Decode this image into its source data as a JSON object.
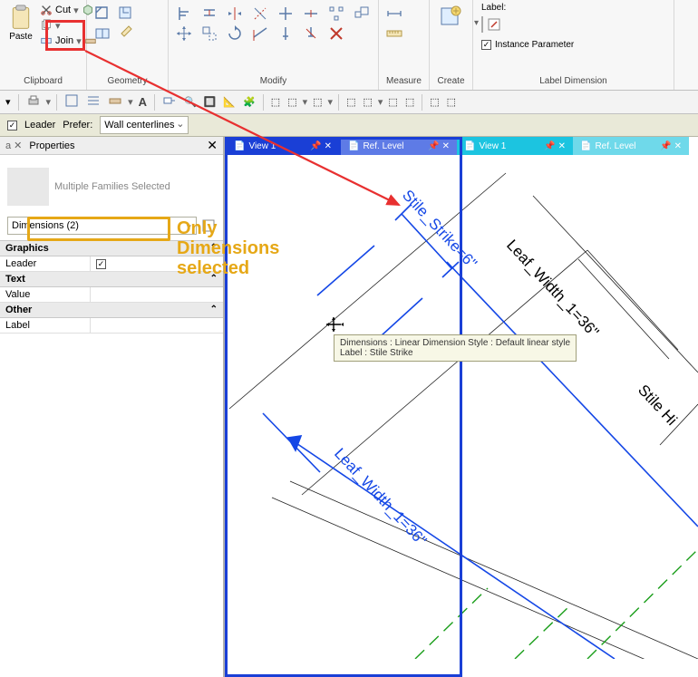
{
  "ribbon": {
    "groups": {
      "clipboard": {
        "label": "Clipboard",
        "paste": "Paste",
        "cut": "Cut",
        "join": "Join"
      },
      "geometry": {
        "label": "Geometry"
      },
      "modify": {
        "label": "Modify"
      },
      "measure": {
        "label": "Measure"
      },
      "create": {
        "label": "Create"
      },
      "label_dimension": {
        "label": "Label Dimension",
        "label_text": "Label:",
        "instance_parameter": "Instance Parameter"
      }
    }
  },
  "options_bar": {
    "leader": "Leader",
    "prefer": "Prefer:",
    "prefer_value": "Wall centerlines"
  },
  "properties": {
    "title": "Properties",
    "type_multi": "Multiple Families Selected",
    "filter": "Dimensions (2)",
    "sections": {
      "graphics": "Graphics",
      "graphics_rows": {
        "leader": "Leader"
      },
      "text": "Text",
      "text_rows": {
        "value": "Value"
      },
      "other": "Other",
      "other_rows": {
        "label": "Label"
      }
    }
  },
  "annotation": "Only Dimensions selected",
  "view_tabs": {
    "t1": "View 1",
    "t2": "Ref. Level",
    "t3": "View 1",
    "t4": "Ref. Level"
  },
  "tooltip": {
    "l1": "Dimensions : Linear Dimension Style : Default linear style",
    "l2": "Label : Stile Strike"
  },
  "drawing_labels": {
    "stile_strike": "Stile_Strike=6\"",
    "leaf_width_top": "Leaf_Width_1=36\"",
    "stile_hinge": "Stile Hi",
    "leaf_width_bottom": "Leaf_Width_1=36\""
  }
}
